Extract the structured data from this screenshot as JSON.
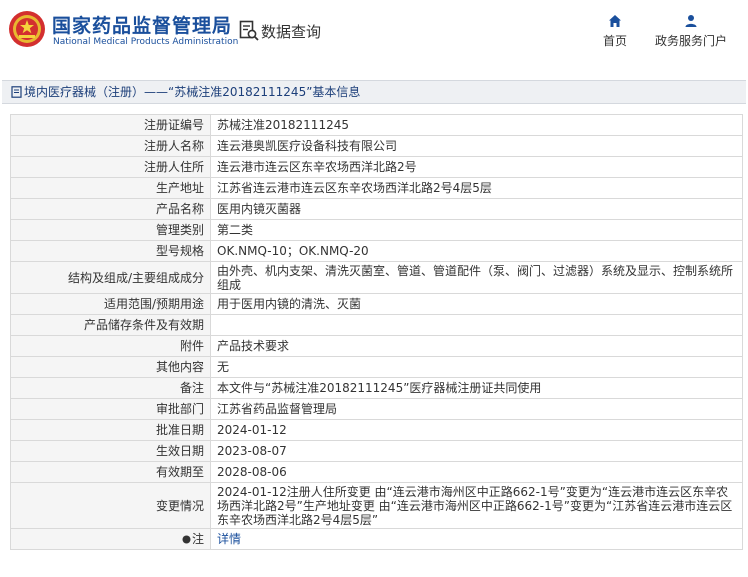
{
  "header": {
    "site_title_cn": "国家药品监督管理局",
    "site_title_en": "National Medical Products Administration",
    "db_query_label": "数据查询",
    "nav": {
      "home": "首页",
      "service": "政务服务门户"
    },
    "brand_color": "#1a4f9c"
  },
  "breadcrumb": {
    "text": "境内医疗器械（注册）——“苏械注准20182111245”基本信息"
  },
  "rows": [
    {
      "label": "注册证编号",
      "value": "苏械注准20182111245"
    },
    {
      "label": "注册人名称",
      "value": "连云港奥凯医疗设备科技有限公司"
    },
    {
      "label": "注册人住所",
      "value": "连云港市连云区东辛农场西洋北路2号"
    },
    {
      "label": "生产地址",
      "value": "江苏省连云港市连云区东辛农场西洋北路2号4层5层"
    },
    {
      "label": "产品名称",
      "value": "医用内镜灭菌器"
    },
    {
      "label": "管理类别",
      "value": "第二类"
    },
    {
      "label": "型号规格",
      "value": "OK.NMQ-10；OK.NMQ-20"
    },
    {
      "label": "结构及组成/主要组成成分",
      "value": "由外壳、机内支架、清洗灭菌室、管道、管道配件（泵、阀门、过滤器）系统及显示、控制系统所组成"
    },
    {
      "label": "适用范围/预期用途",
      "value": "用于医用内镜的清洗、灭菌"
    },
    {
      "label": "产品储存条件及有效期",
      "value": ""
    },
    {
      "label": "附件",
      "value": "产品技术要求"
    },
    {
      "label": "其他内容",
      "value": "无"
    },
    {
      "label": "备注",
      "value": "本文件与“苏械注准20182111245”医疗器械注册证共同使用"
    },
    {
      "label": "审批部门",
      "value": "江苏省药品监督管理局"
    },
    {
      "label": "批准日期",
      "value": "2024-01-12"
    },
    {
      "label": "生效日期",
      "value": "2023-08-07"
    },
    {
      "label": "有效期至",
      "value": "2028-08-06"
    },
    {
      "label": "变更情况",
      "value": "2024-01-12注册人住所变更 由“连云港市海州区中正路662-1号”变更为“连云港市连云区东辛农场西洋北路2号”生产地址变更 由“连云港市海州区中正路662-1号”变更为“江苏省连云港市连云区东辛农场西洋北路2号4层5层”"
    },
    {
      "label": "注",
      "value": "详情"
    }
  ]
}
